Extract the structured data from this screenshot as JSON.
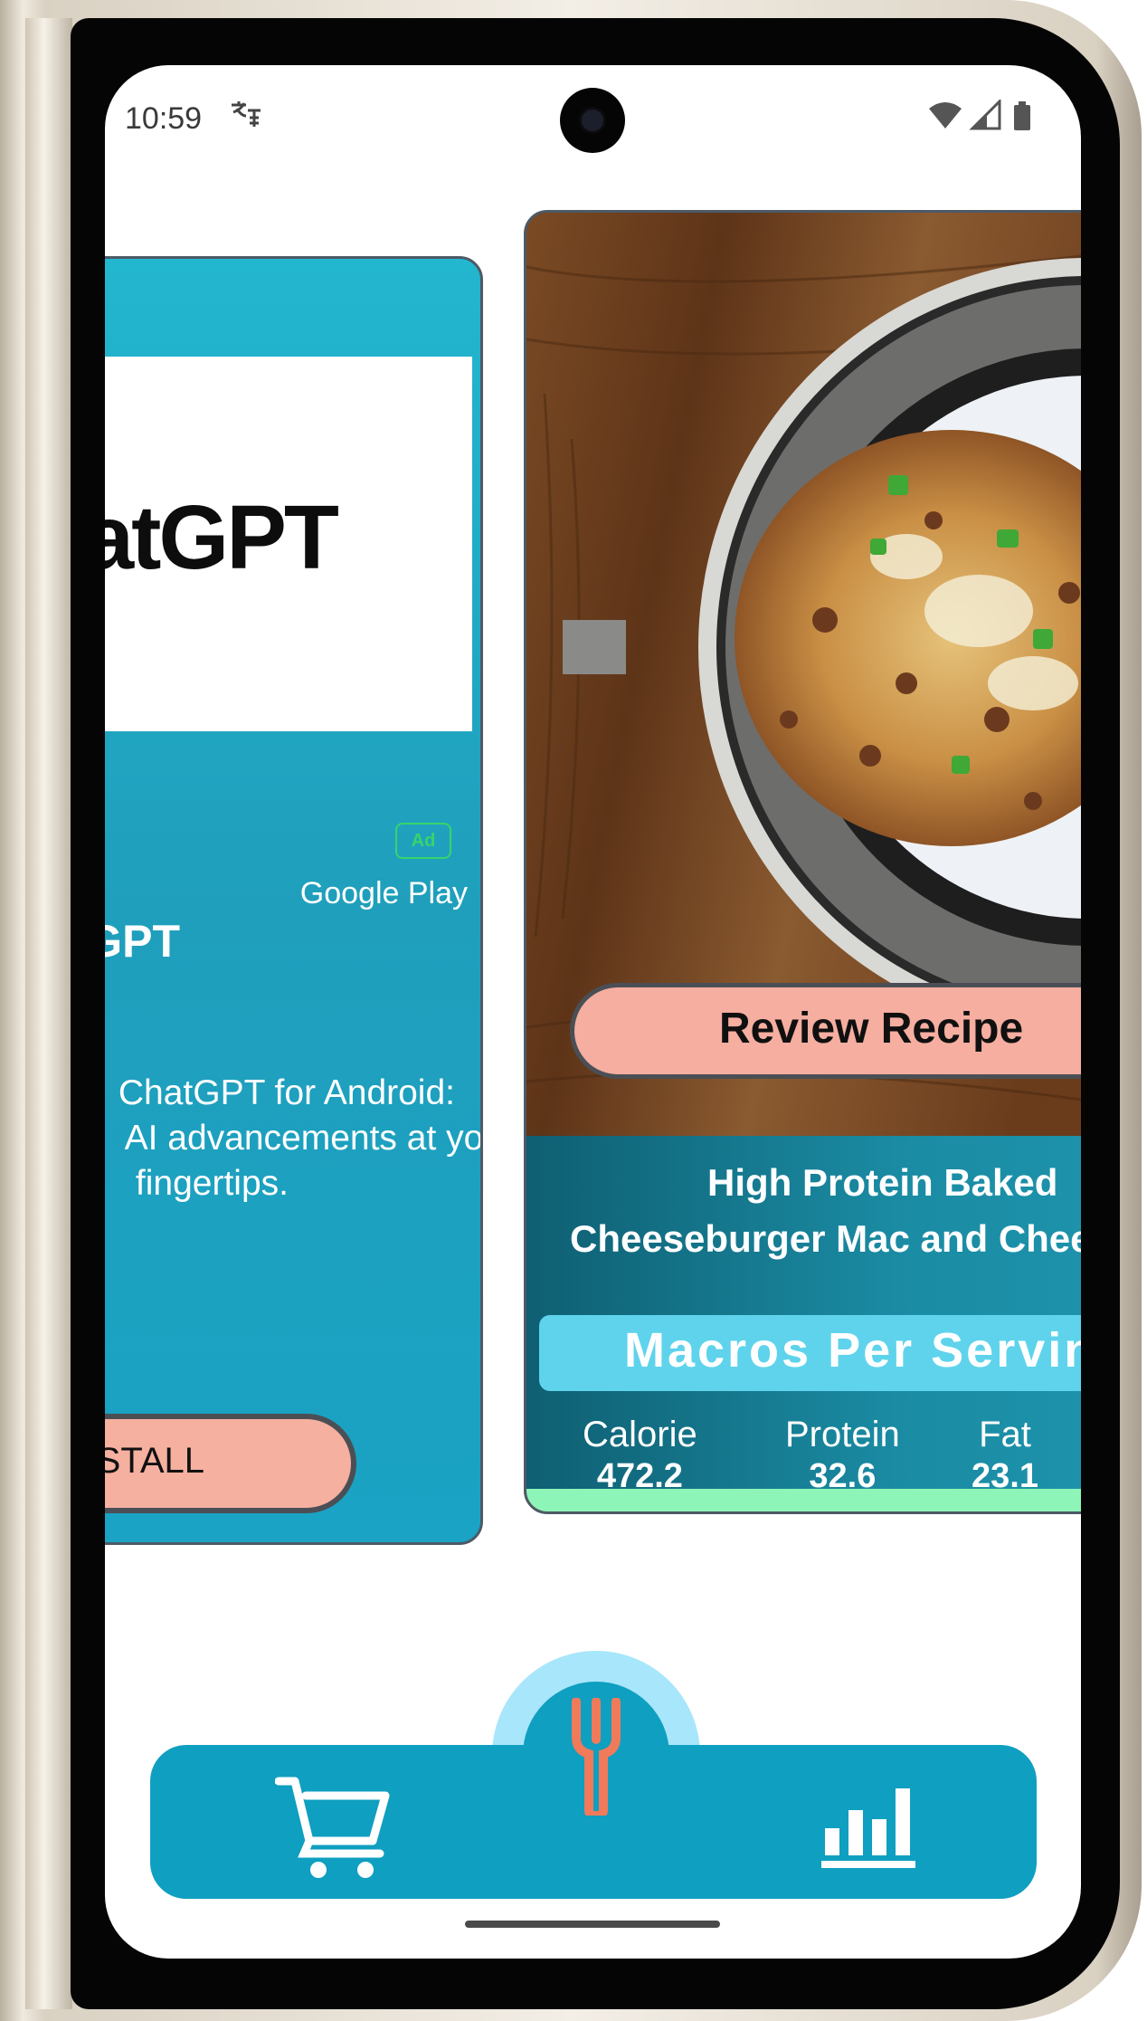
{
  "status_bar": {
    "time": "10:59",
    "notification_icon": "translate-icon",
    "icons": [
      "wifi-icon",
      "cellular-icon",
      "battery-icon"
    ]
  },
  "ad_card": {
    "logo_text": "ChatGPT",
    "badge": "Ad",
    "source": "Google Play",
    "title": "ChatGPT",
    "description_lines": [
      "ChatGPT for Android:",
      "AI advancements at your",
      "fingertips."
    ],
    "install_label": "INSTALL"
  },
  "recipe_card": {
    "review_label": "Review Recipe",
    "title_lines": [
      "High Protein Baked",
      "Cheeseburger Mac and Cheese"
    ],
    "macros_label": "Macros Per Serving",
    "macros": [
      {
        "name": "Calorie",
        "value": "472.2"
      },
      {
        "name": "Protein",
        "value": "32.6"
      },
      {
        "name": "Fat",
        "value": "23.1"
      }
    ]
  },
  "nav": {
    "items": [
      {
        "name": "cart",
        "icon": "cart-icon"
      },
      {
        "name": "recipes",
        "icon": "fork-icon"
      },
      {
        "name": "stats",
        "icon": "bar-chart-icon"
      }
    ]
  },
  "colors": {
    "accent_teal": "#0f9fc0",
    "button_salmon": "#f5aea0",
    "macros_bar": "#5fd3ec",
    "green_strip": "#8ef5b8",
    "fork_orange": "#f07a5a"
  }
}
